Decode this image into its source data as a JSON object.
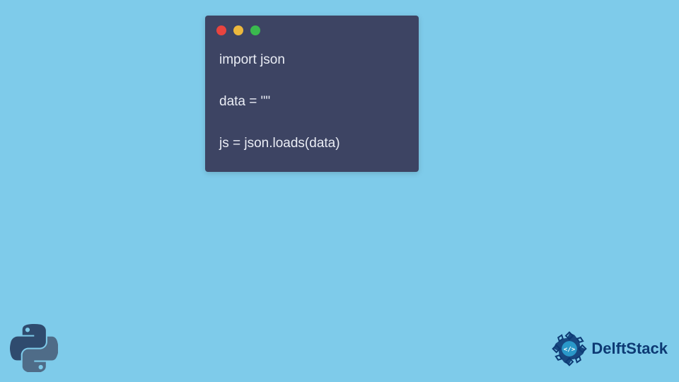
{
  "window": {
    "dots": {
      "red": "close",
      "yellow": "minimize",
      "green": "maximize"
    }
  },
  "code": {
    "content": "import json\n\ndata = \"\"\n\njs = json.loads(data)"
  },
  "branding": {
    "name": "DelftStack"
  },
  "colors": {
    "background": "#7ecbea",
    "window_bg": "#3d4463",
    "code_text": "#eaedf5",
    "brand_text": "#0d3a74"
  }
}
